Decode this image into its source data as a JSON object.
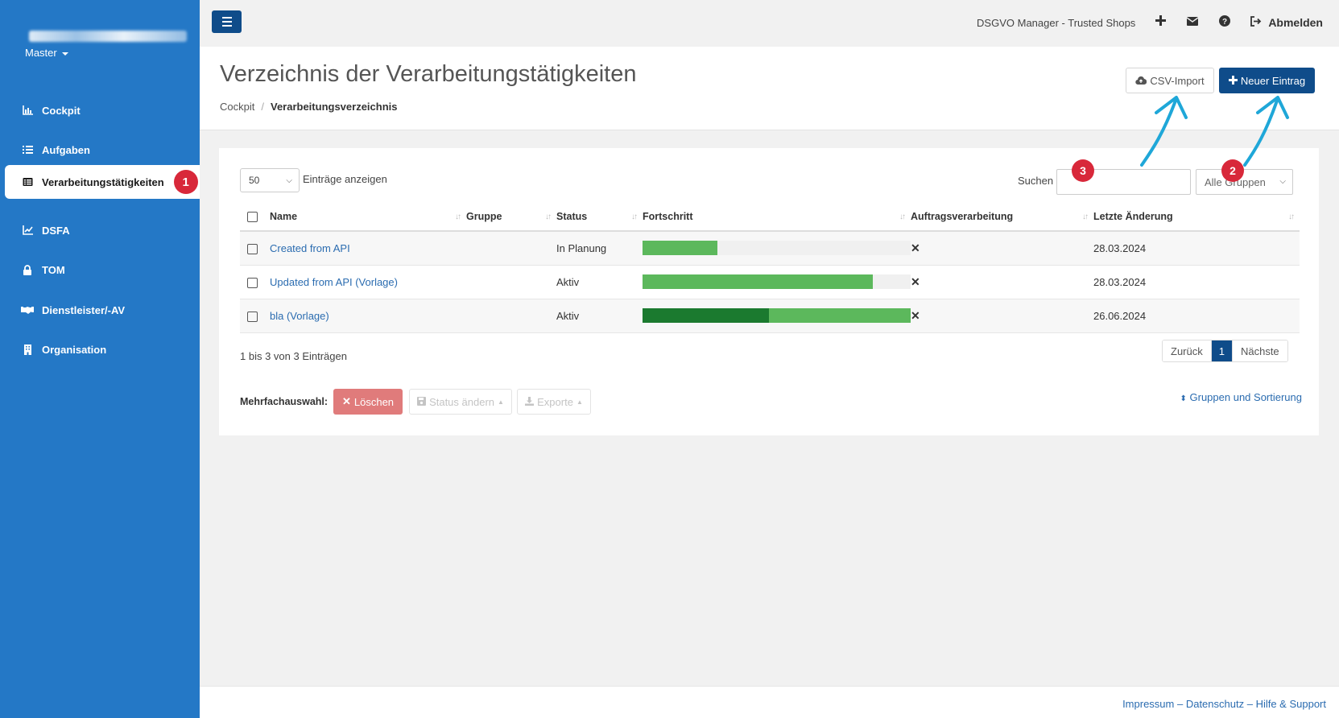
{
  "sidebar": {
    "user_label": "",
    "tenant": "Master",
    "items": [
      {
        "label": "Cockpit",
        "icon": "bar-chart-icon"
      },
      {
        "label": "Aufgaben",
        "icon": "list-icon"
      },
      {
        "label": "Verarbeitungstätigkeiten",
        "icon": "table-list-icon",
        "active": true,
        "badge": "1"
      },
      {
        "label": "DSFA",
        "icon": "line-chart-icon"
      },
      {
        "label": "TOM",
        "icon": "lock-icon"
      },
      {
        "label": "Dienstleister/-AV",
        "icon": "handshake-icon"
      },
      {
        "label": "Organisation",
        "icon": "building-icon"
      }
    ]
  },
  "topbar": {
    "app_name": "DSGVO Manager - Trusted Shops",
    "logout_label": "Abmelden"
  },
  "header": {
    "title": "Verzeichnis der Verarbeitungstätigkeiten",
    "breadcrumb": [
      "Cockpit",
      "Verarbeitungsverzeichnis"
    ],
    "import_label": "CSV-Import",
    "new_label": "Neuer Eintrag"
  },
  "annotations": {
    "badge1": "1",
    "badge2": "2",
    "badge3": "3",
    "color": "#d8283a",
    "arrow_color": "#1fa7d8"
  },
  "table_controls": {
    "page_length": "50",
    "page_length_label": "Einträge anzeigen",
    "search_label": "Suchen",
    "group_filter": "Alle Gruppen"
  },
  "table": {
    "columns": [
      "Name",
      "Gruppe",
      "Status",
      "Fortschritt",
      "Auftragsverarbeitung",
      "Letzte Änderung"
    ],
    "rows": [
      {
        "name": "Created from API",
        "group": "",
        "status": "In Planung",
        "progress_light": 0.28,
        "progress_dark": 0,
        "processing": "✕",
        "changed": "28.03.2024"
      },
      {
        "name": "Updated from API (Vorlage)",
        "group": "",
        "status": "Aktiv",
        "progress_light": 0.86,
        "progress_dark": 0,
        "processing": "✕",
        "changed": "28.03.2024"
      },
      {
        "name": "bla (Vorlage)",
        "group": "",
        "status": "Aktiv",
        "progress_light": 1.0,
        "progress_dark": 0.47,
        "processing": "✕",
        "changed": "26.06.2024"
      }
    ]
  },
  "footer_info": "1 bis 3 von 3 Einträgen",
  "pagination": {
    "prev": "Zurück",
    "current": "1",
    "next": "Nächste"
  },
  "bulk": {
    "label": "Mehrfachauswahl:",
    "delete": "Löschen",
    "status": "Status ändern",
    "export": "Exporte"
  },
  "group_sort_link": "Gruppen und Sortierung",
  "footer": {
    "impressum": "Impressum",
    "datenschutz": "Datenschutz",
    "help": "Hilfe & Support"
  }
}
